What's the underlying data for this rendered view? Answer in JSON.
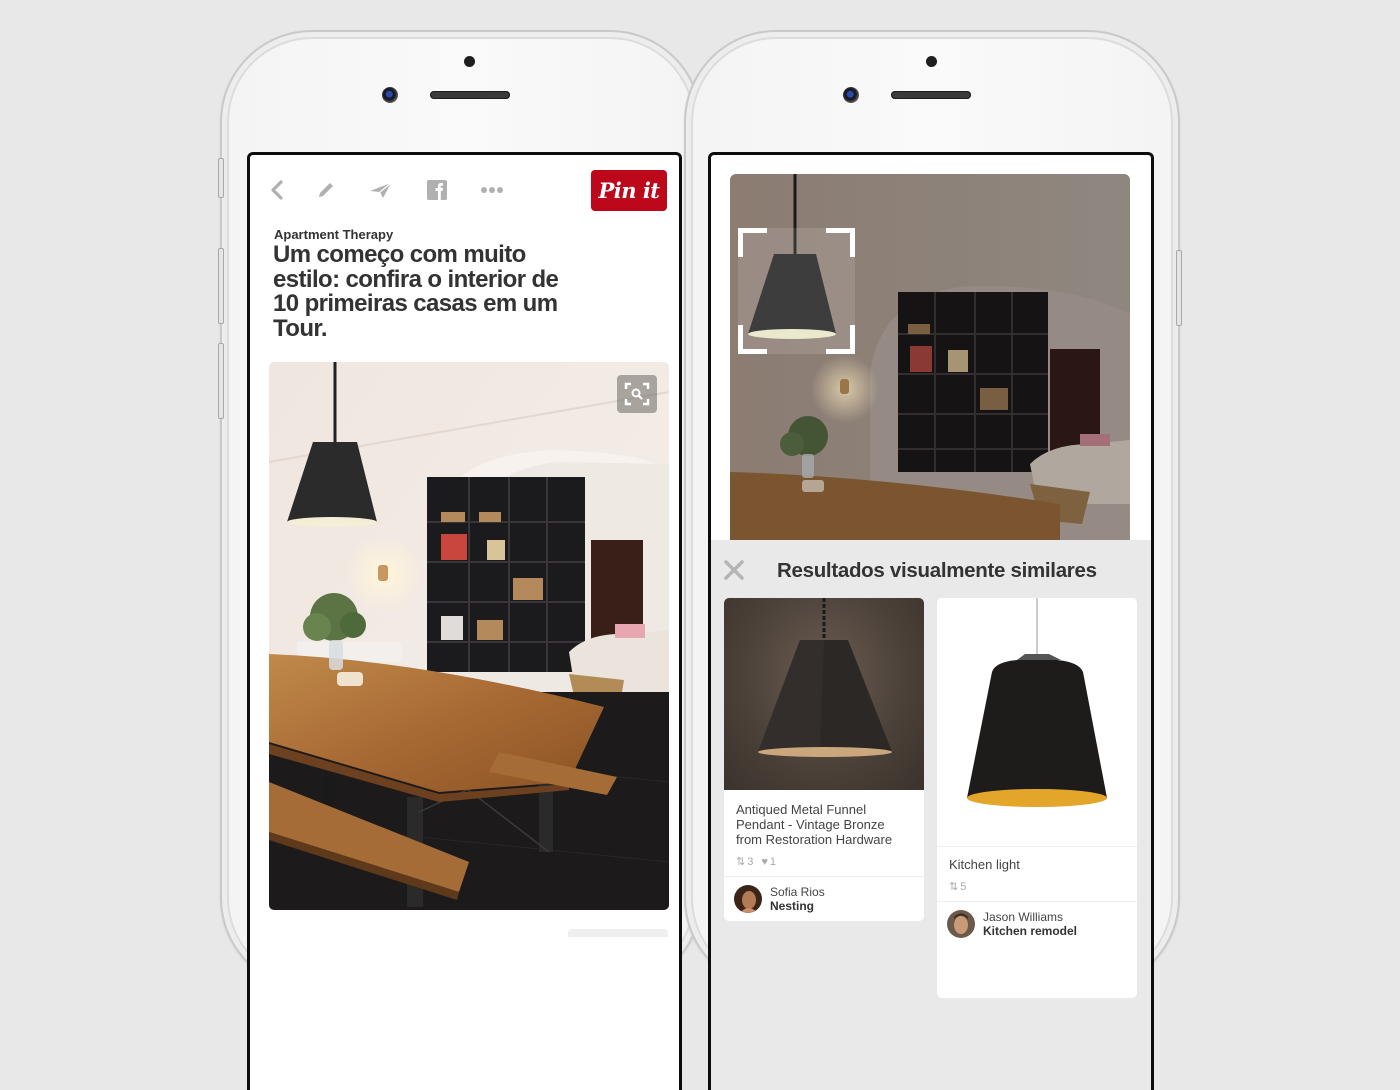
{
  "left_phone": {
    "toolbar": {
      "icons": [
        "back-chevron-icon",
        "edit-pencil-icon",
        "send-icon",
        "facebook-icon",
        "more-icon"
      ],
      "pin_it_label": "Pin it",
      "pin_it_color": "#bd081c"
    },
    "article": {
      "source": "Apartment Therapy",
      "title": "Um começo com muito estilo: confira o interior de 10 primeiras casas em um Tour."
    },
    "hero_image": {
      "description": "Dining room with black pendant lamp, wooden table, benches and black bookshelves",
      "visual_search_icon": "visual-search-icon"
    }
  },
  "right_phone": {
    "photo": {
      "description": "Same dining room photo with crop selector around pendant lamp"
    },
    "results": {
      "title": "Resultados visualmente similares",
      "close_icon": "close-icon",
      "cards": [
        {
          "title": "Antiqued Metal Funnel Pendant - Vintage Bronze from Restoration Hardware",
          "repins": "3",
          "likes": "1",
          "pinner_name": "Sofia Rios",
          "board": "Nesting"
        },
        {
          "title": "Kitchen light",
          "repins": "5",
          "pinner_name": "Jason Williams",
          "board": "Kitchen remodel"
        }
      ]
    }
  }
}
